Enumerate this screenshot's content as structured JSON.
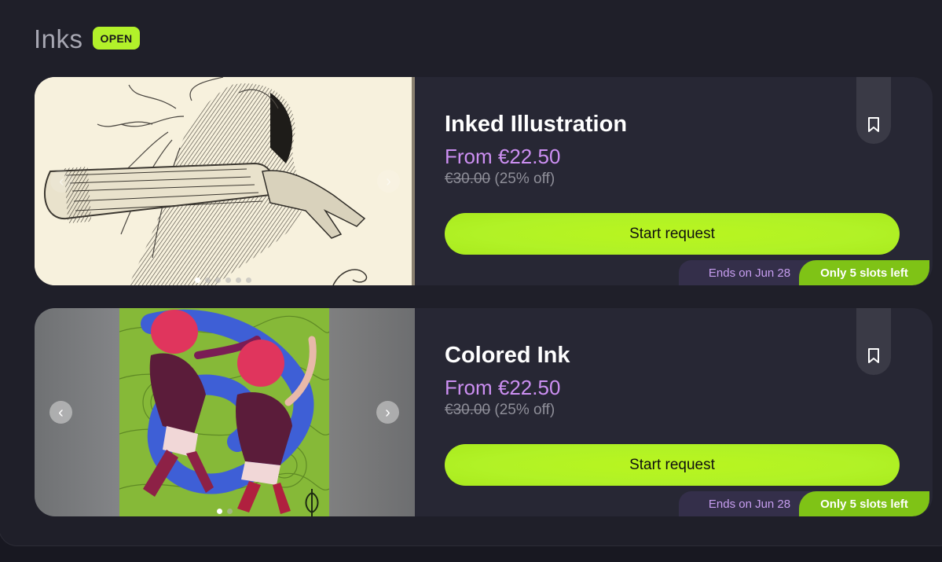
{
  "section": {
    "title": "Inks",
    "badge": "OPEN"
  },
  "cards": [
    {
      "title": "Inked Illustration",
      "price": "From €22.50",
      "old_price": "€30.00",
      "discount": "(25% off)",
      "button": "Start request",
      "ends": "Ends on Jun 28",
      "slots": "Only 5 slots left",
      "carousel": {
        "slides": 6,
        "active": 1
      }
    },
    {
      "title": "Colored Ink",
      "price": "From €22.50",
      "old_price": "€30.00",
      "discount": "(25% off)",
      "button": "Start request",
      "ends": "Ends on Jun 28",
      "slots": "Only 5 slots left",
      "carousel": {
        "slides": 2,
        "active": 1
      }
    }
  ],
  "icons": {
    "prev": "chevron-left-icon",
    "next": "chevron-right-icon",
    "bookmark": "bookmark-icon"
  },
  "colors": {
    "accent": "#b2f12a",
    "price": "#cc8ff2",
    "card_bg": "#272734",
    "page_bg": "#1f1f29"
  }
}
